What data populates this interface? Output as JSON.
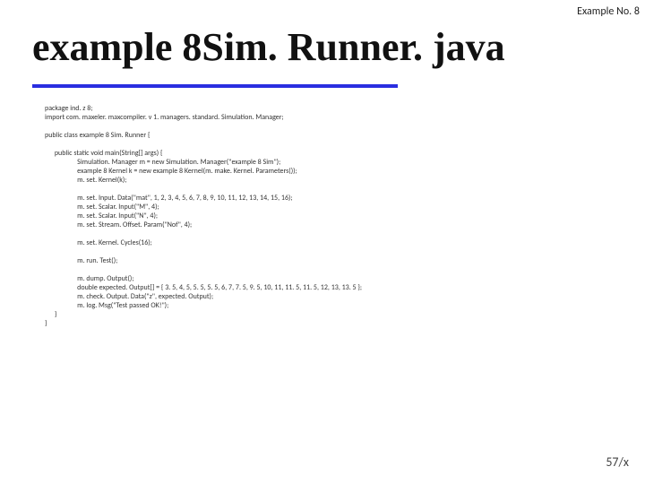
{
  "topRight": "Example No. 8",
  "title": "example 8Sim. Runner. java",
  "pageNumber": "57/x",
  "code": {
    "l01": "package ind. z 8;",
    "l02": "import com. maxeler. maxcompiler. v 1. managers. standard. Simulation. Manager;",
    "l03": "public class example 8 Sim. Runner {",
    "l04": "      public static void main(String[] args) {",
    "l05": "                    Simulation. Manager m = new Simulation. Manager(\"example 8 Sim\");",
    "l06": "                    example 8 Kernel k = new example 8 Kernel(m. make. Kernel. Parameters());",
    "l07": "                    m. set. Kernel(k);",
    "l08": "                    m. set. Input. Data(\"mat\", 1, 2, 3, 4, 5, 6, 7, 8, 9, 10, 11, 12, 13, 14, 15, 16);",
    "l09": "                    m. set. Scalar. Input(\"M\", 4);",
    "l10": "                    m. set. Scalar. Input(\"N\", 4);",
    "l11": "                    m. set. Stream. Offset. Param(\"Nof\", 4);",
    "l12": "                    m. set. Kernel. Cycles(16);",
    "l13": "                    m. run. Test();",
    "l14": "                    m. dump. Output();",
    "l15": "                    double expected. Output[] = { 3. 5, 4, 5, 5. 5, 5. 5, 6, 7, 7. 5, 9. 5, 10, 11, 11. 5, 11. 5, 12, 13, 13. 5 };",
    "l16": "                    m. check. Output. Data(\"z\", expected. Output);",
    "l17": "                    m. log. Msg(\"Test passed OK!\");",
    "l18": "      }",
    "l19": "}"
  }
}
